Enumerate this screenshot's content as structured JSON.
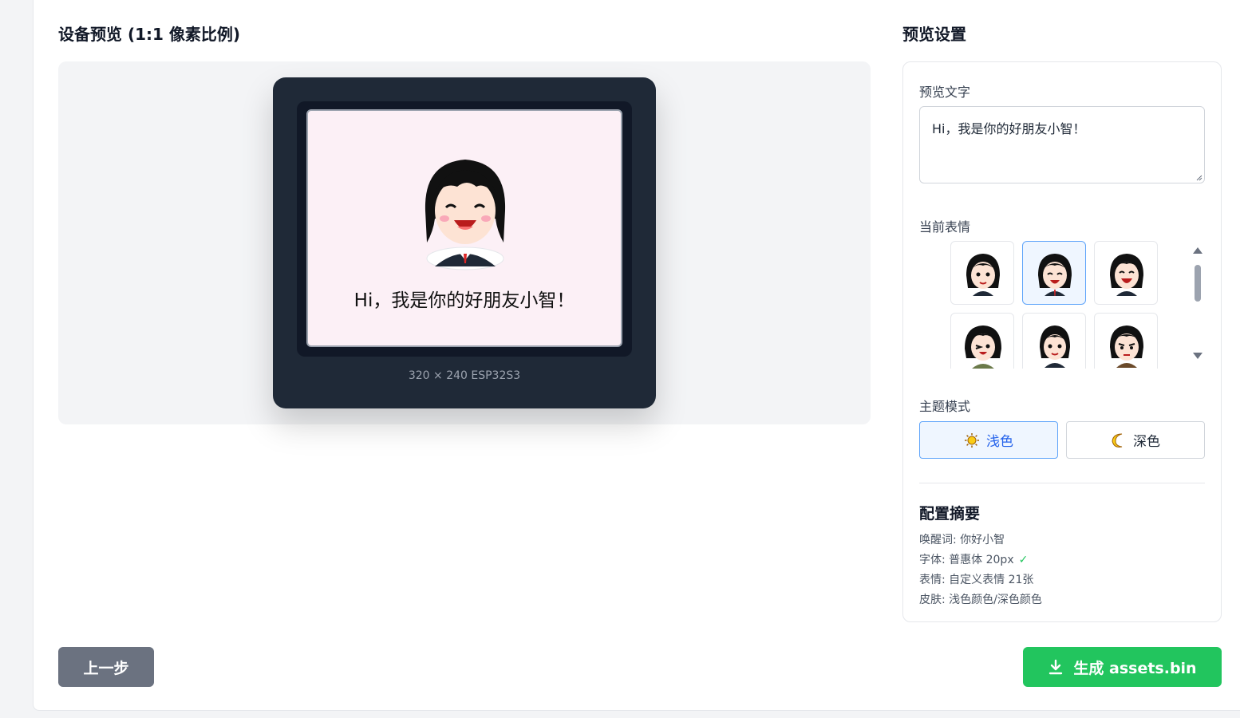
{
  "preview": {
    "title": "设备预览 (1:1 像素比例)",
    "screen_text": "Hi，我是你的好朋友小智！",
    "device_label": "320 × 240 ESP32S3",
    "screen_bg": "#fcf0f6"
  },
  "settings": {
    "title": "预览设置",
    "preview_text_label": "预览文字",
    "preview_text_value": "Hi，我是你的好朋友小智！",
    "emotion_label": "当前表情",
    "emotions": [
      {
        "icon": "girl-neutral-icon",
        "selected": false
      },
      {
        "icon": "girl-happy-icon",
        "selected": true
      },
      {
        "icon": "girl-laughing-icon",
        "selected": false
      },
      {
        "icon": "girl-wink-icon",
        "selected": false
      },
      {
        "icon": "girl-smile-icon",
        "selected": false
      },
      {
        "icon": "girl-serious-icon",
        "selected": false
      }
    ],
    "theme_label": "主题模式",
    "theme_light": "浅色",
    "theme_dark": "深色",
    "theme_selected": "light",
    "summary_title": "配置摘要",
    "summary": {
      "wake_word": "唤醒词: 你好小智",
      "font": "字体: 普惠体 20px",
      "font_check": "✓",
      "emotion": "表情: 自定义表情 21张",
      "skin": "皮肤: 浅色颜色/深色颜色"
    }
  },
  "actions": {
    "back": "上一步",
    "generate": "生成 assets.bin"
  },
  "colors": {
    "accent": "#2563eb",
    "generate_green": "#22c55e",
    "back_gray": "#6b7280",
    "device_dark": "#1f2937"
  }
}
